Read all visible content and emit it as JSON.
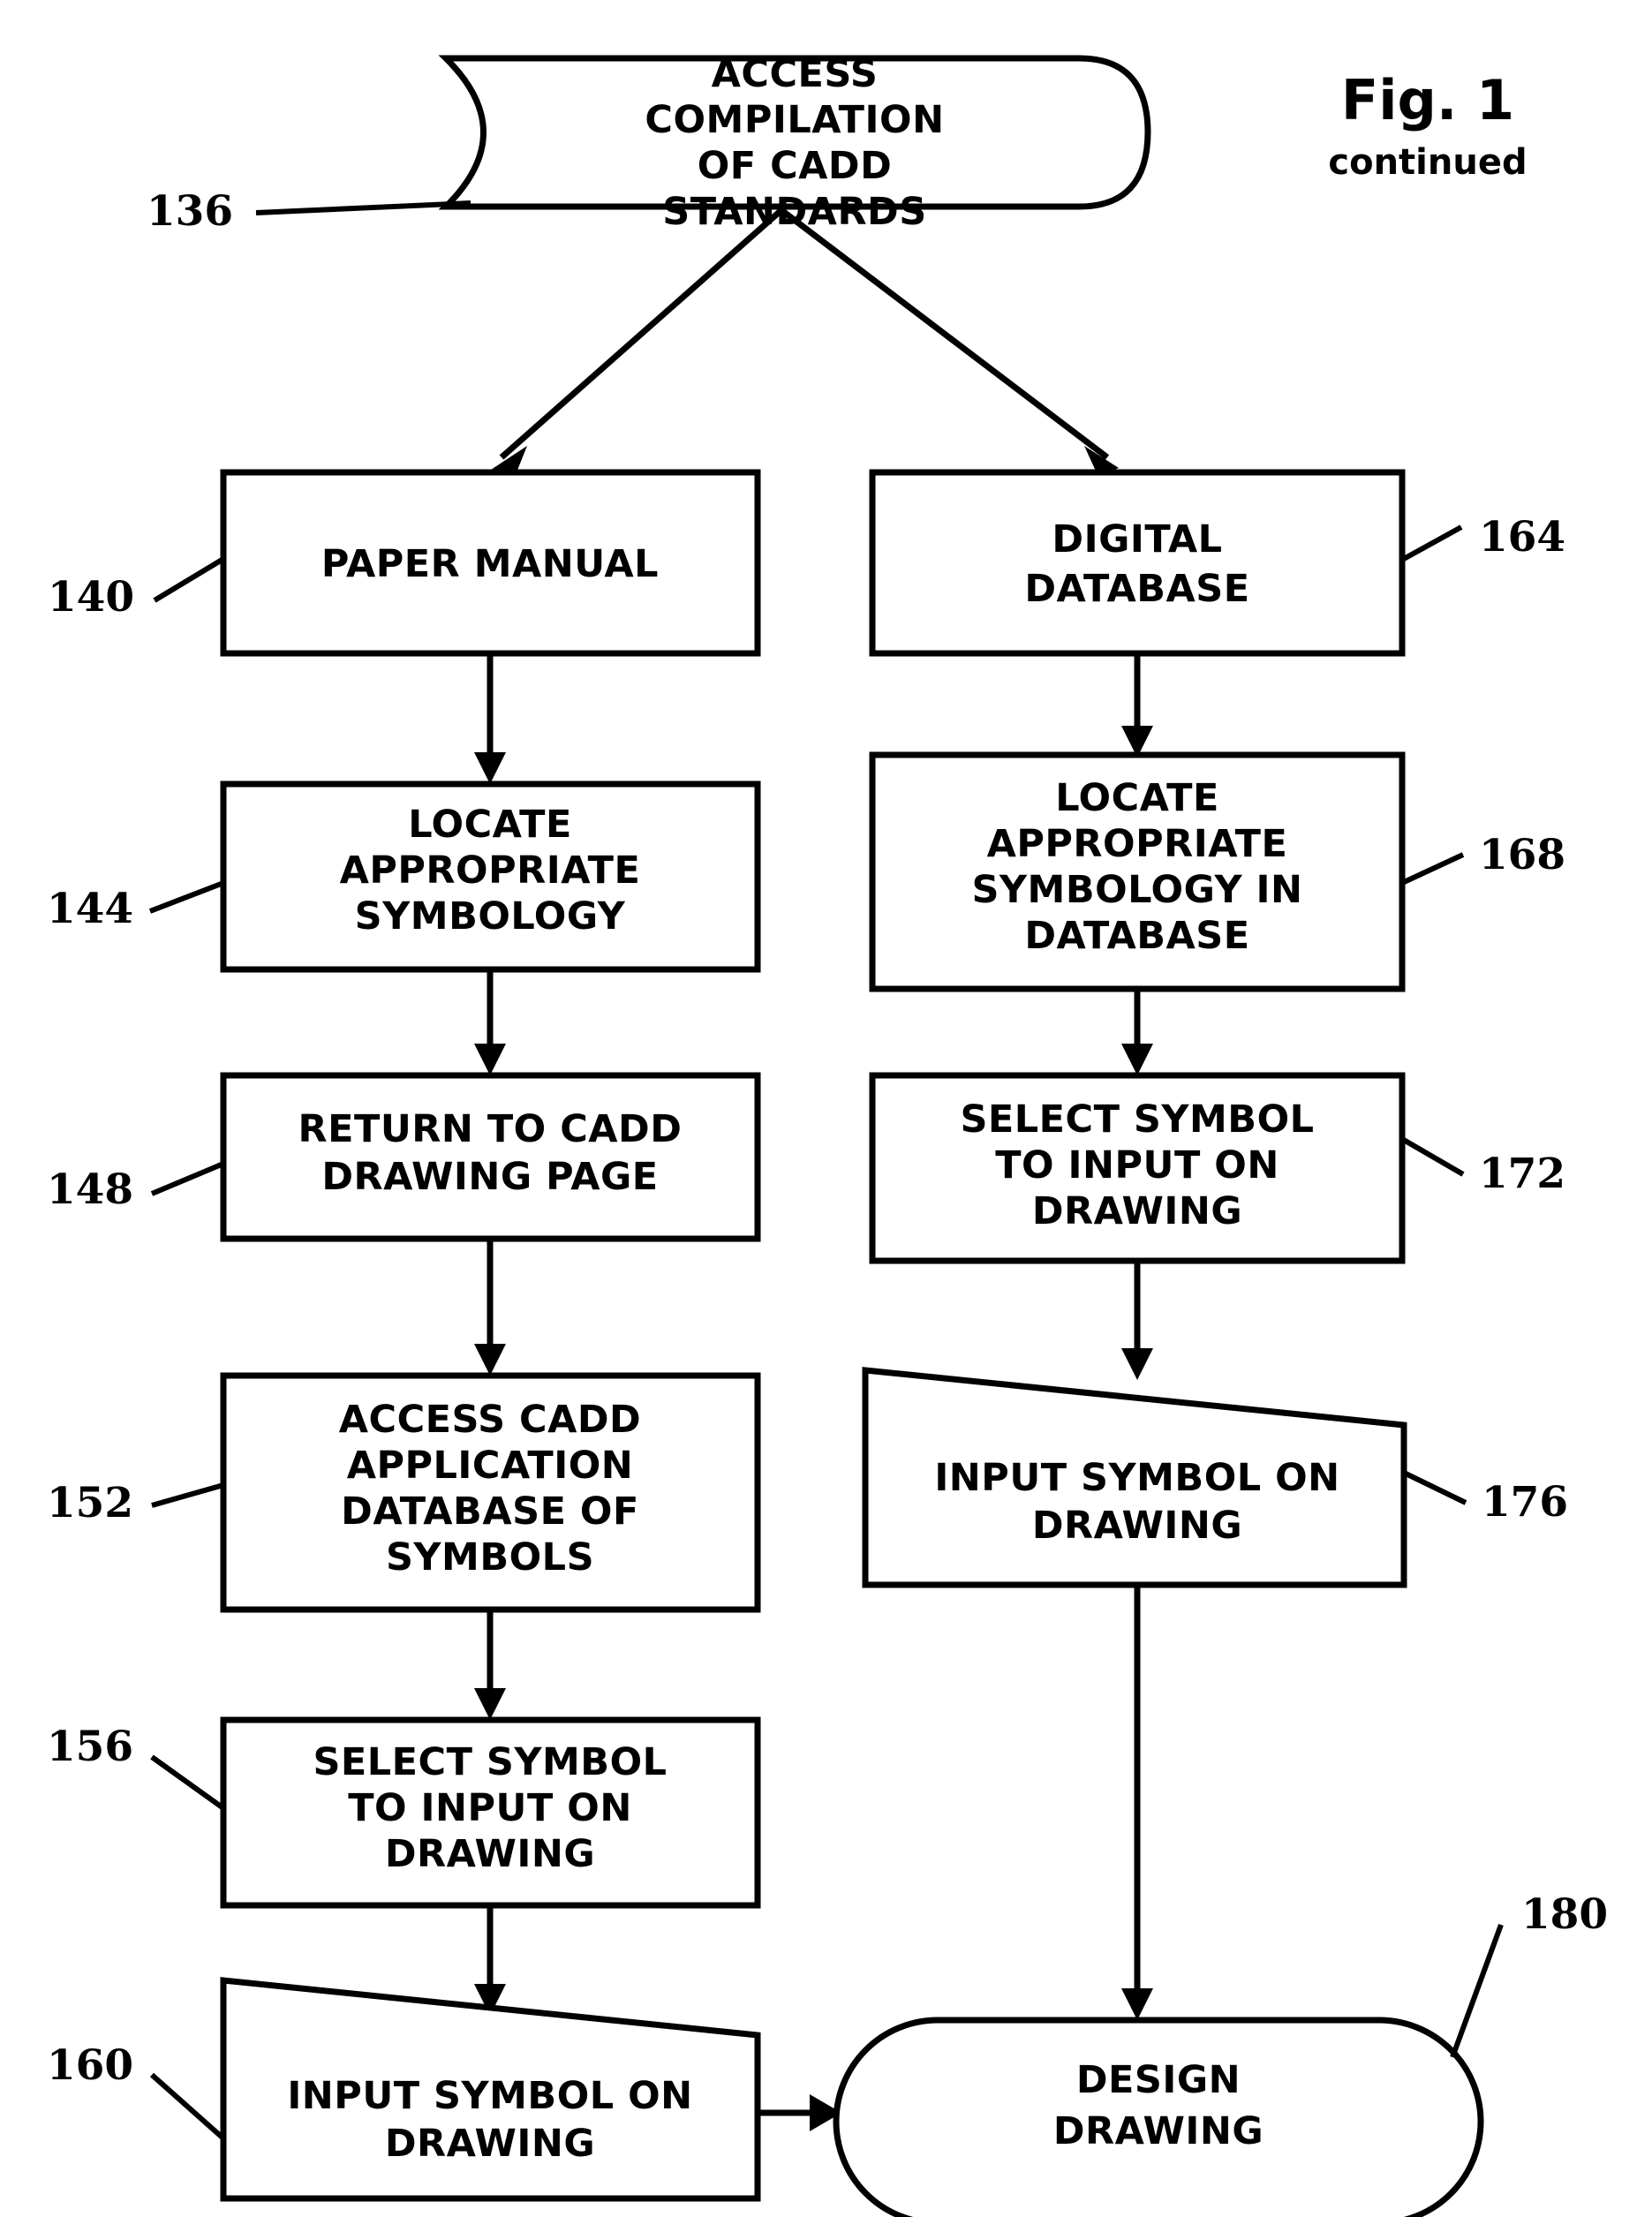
{
  "figure": {
    "title": "Fig. 1",
    "subtitle": "continued"
  },
  "nodes": {
    "access_compilation": {
      "ref": "136",
      "shape": "stored-data",
      "lines": [
        "ACCESS",
        "COMPILATION",
        "OF CADD",
        "STANDARDS"
      ]
    },
    "paper_manual": {
      "ref": "140",
      "shape": "rectangle",
      "lines": [
        "PAPER MANUAL"
      ]
    },
    "locate_symbology": {
      "ref": "144",
      "shape": "rectangle",
      "lines": [
        "LOCATE",
        "APPROPRIATE",
        "SYMBOLOGY"
      ]
    },
    "return_to_cadd": {
      "ref": "148",
      "shape": "rectangle",
      "lines": [
        "RETURN TO CADD",
        "DRAWING PAGE"
      ]
    },
    "access_cadd_app_db": {
      "ref": "152",
      "shape": "rectangle",
      "lines": [
        "ACCESS CADD",
        "APPLICATION",
        "DATABASE OF",
        "SYMBOLS"
      ]
    },
    "select_symbol_left": {
      "ref": "156",
      "shape": "rectangle",
      "lines": [
        "SELECT SYMBOL",
        "TO INPUT ON",
        "DRAWING"
      ]
    },
    "input_symbol_left": {
      "ref": "160",
      "shape": "manual-input",
      "lines": [
        "INPUT SYMBOL ON",
        "DRAWING"
      ]
    },
    "digital_database": {
      "ref": "164",
      "shape": "rectangle",
      "lines": [
        "DIGITAL",
        "DATABASE"
      ]
    },
    "locate_symbology_db": {
      "ref": "168",
      "shape": "rectangle",
      "lines": [
        "LOCATE",
        "APPROPRIATE",
        "SYMBOLOGY IN",
        "DATABASE"
      ]
    },
    "select_symbol_right": {
      "ref": "172",
      "shape": "rectangle",
      "lines": [
        "SELECT SYMBOL",
        "TO INPUT ON",
        "DRAWING"
      ]
    },
    "input_symbol_right": {
      "ref": "176",
      "shape": "manual-input",
      "lines": [
        "INPUT SYMBOL ON",
        "DRAWING"
      ]
    },
    "design_drawing": {
      "ref": "180",
      "shape": "stadium",
      "lines": [
        "DESIGN",
        "DRAWING"
      ]
    }
  },
  "colors": {
    "stroke": "#000000",
    "fill": "#ffffff",
    "text": "#000000"
  }
}
